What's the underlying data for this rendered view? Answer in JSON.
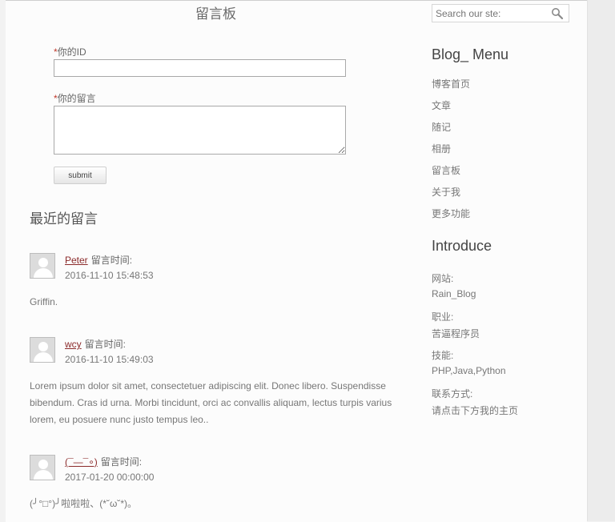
{
  "board_title": "留言板",
  "form": {
    "required_mark": "*",
    "id_label": "你的ID",
    "id_value": "",
    "message_label": "你的留言",
    "message_value": "",
    "submit_label": "submit"
  },
  "recent_title": "最近的留言",
  "comment_time_label": "留言时间:",
  "comments": [
    {
      "author": "Peter",
      "time": "2016-11-10 15:48:53",
      "text": "Griffin."
    },
    {
      "author": "wcy",
      "time": "2016-11-10 15:49:03",
      "text": "Lorem ipsum dolor sit amet, consectetuer adipiscing elit. Donec libero. Suspendisse bibendum. Cras id urna. Morbi tincidunt, orci ac convallis aliquam, lectus turpis varius lorem, eu posuere nunc justo tempus leo.."
    },
    {
      "author": "(¯—¯∘)",
      "time": "2017-01-20 00:00:00",
      "text": "(╯°□°)╯啦啦啦、(*˘ω˘*)。"
    }
  ],
  "sidebar": {
    "search_placeholder": "Search our ste:",
    "menu_title": "Blog_ Menu",
    "menu_items": [
      "博客首页",
      "文章",
      "随记",
      "相册",
      "留言板",
      "关于我",
      "更多功能"
    ],
    "intro_title": "Introduce",
    "intro": [
      {
        "label": "网站:",
        "value": "Rain_Blog"
      },
      {
        "label": "职业:",
        "value": "苦逼程序员"
      },
      {
        "label": "技能:",
        "value": "PHP,Java,Python"
      },
      {
        "label": "联系方式:",
        "value": "请点击下方我的主页"
      }
    ]
  }
}
